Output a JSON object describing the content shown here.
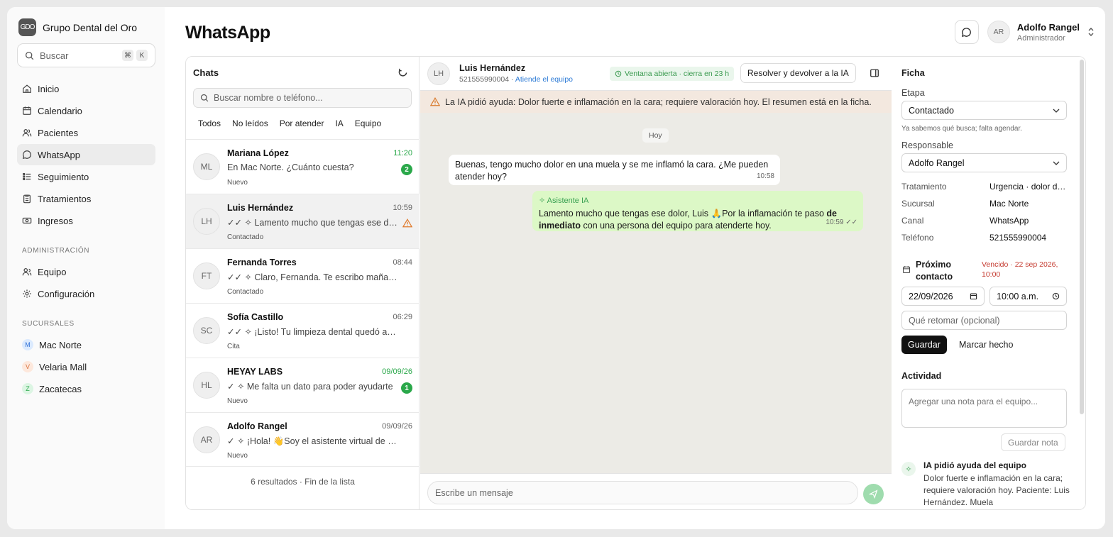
{
  "sidebar": {
    "brand": "Grupo Dental del Oro",
    "logo_text": "GDO",
    "search_placeholder": "Buscar",
    "shortcut": [
      "⌘",
      "K"
    ],
    "nav": [
      {
        "label": "Inicio",
        "icon": "home-icon"
      },
      {
        "label": "Calendario",
        "icon": "calendar-icon"
      },
      {
        "label": "Pacientes",
        "icon": "users-icon"
      },
      {
        "label": "WhatsApp",
        "icon": "chat-icon",
        "active": true
      },
      {
        "label": "Seguimiento",
        "icon": "list-icon"
      },
      {
        "label": "Tratamientos",
        "icon": "clipboard-icon"
      },
      {
        "label": "Ingresos",
        "icon": "money-icon"
      }
    ],
    "admin_heading": "ADMINISTRACIÓN",
    "admin": [
      {
        "label": "Equipo",
        "icon": "team-icon"
      },
      {
        "label": "Configuración",
        "icon": "gear-icon"
      }
    ],
    "branches_heading": "SUCURSALES",
    "branches": [
      {
        "initial": "M",
        "label": "Mac Norte",
        "color": "#dbeafe",
        "text": "#2d6fd6"
      },
      {
        "initial": "V",
        "label": "Velaria Mall",
        "color": "#fde8dc",
        "text": "#d9703b"
      },
      {
        "initial": "Z",
        "label": "Zacatecas",
        "color": "#dcf5e3",
        "text": "#2aa84a"
      }
    ]
  },
  "header": {
    "title": "WhatsApp",
    "user_initials": "AR",
    "user_name": "Adolfo Rangel",
    "user_role": "Administrador"
  },
  "chats": {
    "title": "Chats",
    "search_placeholder": "Buscar nombre o teléfono...",
    "filters": [
      "Todos",
      "No leídos",
      "Por atender",
      "IA",
      "Equipo"
    ],
    "items": [
      {
        "initials": "ML",
        "name": "Mariana López",
        "time": "11:20",
        "preview": "En Mac Norte. ¿Cuánto cuesta?",
        "status": "Nuevo",
        "badge": "2"
      },
      {
        "initials": "LH",
        "name": "Luis Hernández",
        "time": "10:59",
        "preview": "✓✓ ✧ Lamento mucho que tengas ese dolor, Luis",
        "status": "Contactado"
      },
      {
        "initials": "FT",
        "name": "Fernanda Torres",
        "time": "08:44",
        "preview": "✓✓ ✧ Claro, Fernanda. Te escribo mañana para confirmar",
        "status": "Contactado"
      },
      {
        "initials": "SC",
        "name": "Sofía Castillo",
        "time": "06:29",
        "preview": "✓✓ ✧ ¡Listo! Tu limpieza dental quedó agendada",
        "status": "Cita"
      },
      {
        "initials": "HL",
        "name": "HEYAY LABS",
        "time": "09/09/26",
        "preview": "✓ ✧ Me falta un dato para poder ayudarte",
        "status": "Nuevo",
        "badge": "1"
      },
      {
        "initials": "AR",
        "name": "Adolfo Rangel",
        "time": "09/09/26",
        "preview": "✓ ✧ ¡Hola! 👋Soy el asistente virtual de Grupo Dental",
        "status": "Nuevo"
      }
    ],
    "footer": "6 resultados · Fin de la lista"
  },
  "conversation": {
    "initials": "LH",
    "name": "Luis Hernández",
    "phone": "521555990004",
    "handler": "Atiende el equipo",
    "window_badge": "Ventana abierta · cierra en 23 h",
    "resolve_label": "Resolver y devolver a la IA",
    "alert": "La IA pidió ayuda: Dolor fuerte e inflamación en la cara; requiere valoración hoy. El resumen está en la ficha.",
    "day": "Hoy",
    "incoming": {
      "text": "Buenas, tengo mucho dolor en una muela y se me inflamó la cara. ¿Me pueden atender hoy?",
      "time": "10:58"
    },
    "outgoing": {
      "tag": "Asistente IA",
      "text_a": "Lamento mucho que tengas ese dolor, Luis 🙏Por la inflamación te paso ",
      "text_bold": "de inmediato",
      "text_b": " con una persona del equipo para atenderte hoy.",
      "time": "10:59"
    },
    "composer_placeholder": "Escribe un mensaje"
  },
  "ficha": {
    "title": "Ficha",
    "stage_label": "Etapa",
    "stage": "Contactado",
    "stage_hint": "Ya sabemos qué busca; falta agendar.",
    "owner_label": "Responsable",
    "owner": "Adolfo Rangel",
    "fields": [
      {
        "k": "Tratamiento",
        "v": "Urgencia · dolor dental"
      },
      {
        "k": "Sucursal",
        "v": "Mac Norte"
      },
      {
        "k": "Canal",
        "v": "WhatsApp"
      },
      {
        "k": "Teléfono",
        "v": "521555990004"
      }
    ],
    "next_label_1": "Próximo",
    "next_label_2": "contacto",
    "due_1": "Vencido · 22 sep 2026,",
    "due_2": "10:00",
    "date": "22/09/2026",
    "time": "10:00 a.m.",
    "retake_placeholder": "Qué retomar (opcional)",
    "save": "Guardar",
    "mark_done": "Marcar hecho",
    "activity_title": "Actividad",
    "note_placeholder": "Agregar una nota para el equipo...",
    "save_note": "Guardar nota",
    "event_title": "IA pidió ayuda del equipo",
    "event_body": "Dolor fuerte e inflamación en la cara; requiere valoración hoy. Paciente: Luis Hernández. Muela"
  },
  "colors": {
    "accent_green": "#2aa84a",
    "alert_bg": "#f3e8df",
    "chat_bg": "#ecebe6",
    "due_red": "#c53b30"
  }
}
